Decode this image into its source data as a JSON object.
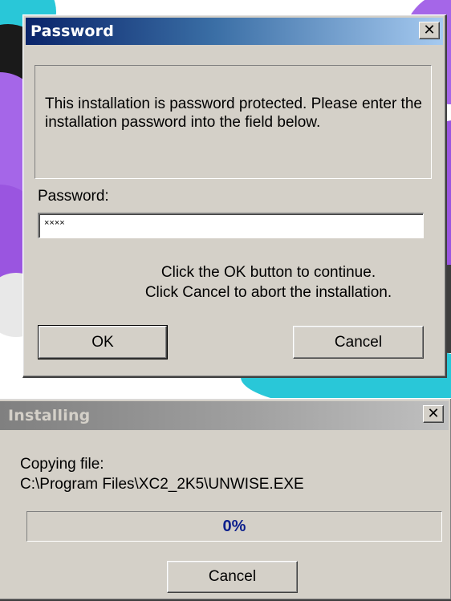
{
  "password_dialog": {
    "title": "Password",
    "close_glyph": "✕",
    "message": "This installation is password protected. Please enter the installation password into the field below.",
    "password_label": "Password:",
    "password_value": "××××",
    "hint_line1": "Click the OK button to continue.",
    "hint_line2": "Click Cancel to abort the installation.",
    "ok_label": "OK",
    "cancel_label": "Cancel"
  },
  "installing_dialog": {
    "title": "Installing",
    "close_glyph": "✕",
    "status_label": "Copying file:",
    "file_path": "C:\\Program Files\\XC2_2K5\\UNWISE.EXE",
    "progress": 0,
    "progress_text": "0%",
    "cancel_label": "Cancel"
  },
  "colors": {
    "window_face": "#d4d0c8",
    "active_title": "#0a246a",
    "inactive_title": "#808080",
    "progress_text": "#0a1e8c"
  },
  "icons": [
    "close-icon"
  ]
}
